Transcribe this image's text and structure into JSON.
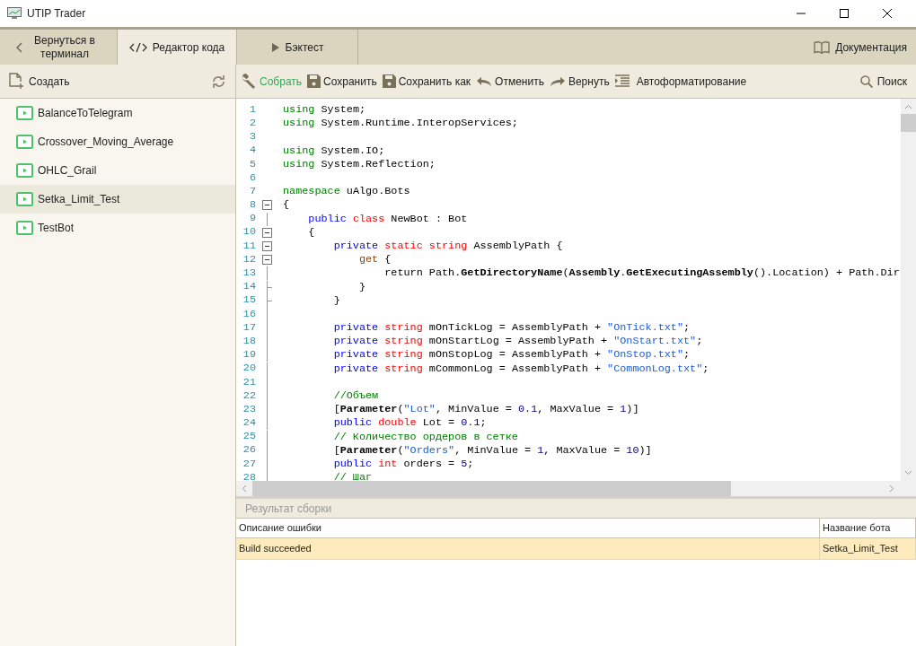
{
  "window": {
    "title": "UTIP Trader"
  },
  "tabs": [
    {
      "label": "Вернуться в терминал",
      "kind": "back",
      "selected": false
    },
    {
      "label": "Редактор кода",
      "kind": "code",
      "selected": true
    },
    {
      "label": "Бэктест",
      "kind": "play",
      "selected": false
    }
  ],
  "docs_link": "Документация",
  "sidebar": {
    "create": "Создать",
    "items": [
      {
        "label": "BalanceToTelegram",
        "selected": false
      },
      {
        "label": "Crossover_Moving_Average",
        "selected": false
      },
      {
        "label": "OHLC_Grail",
        "selected": false
      },
      {
        "label": "Setka_Limit_Test",
        "selected": true
      },
      {
        "label": "TestBot",
        "selected": false
      }
    ]
  },
  "toolbar": [
    {
      "label": "Собрать",
      "kind": "build"
    },
    {
      "label": "Сохранить",
      "kind": "save"
    },
    {
      "label": "Сохранить как",
      "kind": "save"
    },
    {
      "label": "Отменить",
      "kind": "undo"
    },
    {
      "label": "Вернуть",
      "kind": "redo"
    },
    {
      "label": "Автоформатирование",
      "kind": "format"
    }
  ],
  "search": "Поиск",
  "code": [
    {
      "n": "1",
      "kind": "plain",
      "tokens": [
        {
          "kind": "kg",
          "text": "using"
        },
        {
          "kind": "p",
          "text": " System;"
        }
      ]
    },
    {
      "n": "2",
      "kind": "plain",
      "tokens": [
        {
          "kind": "kg",
          "text": "using"
        },
        {
          "kind": "p",
          "text": " System.Runtime.InteropServices;"
        }
      ]
    },
    {
      "n": "3",
      "kind": "plain"
    },
    {
      "n": "4",
      "kind": "plain",
      "tokens": [
        {
          "kind": "kg",
          "text": "using"
        },
        {
          "kind": "p",
          "text": " System.IO;"
        }
      ]
    },
    {
      "n": "5",
      "kind": "plain",
      "tokens": [
        {
          "kind": "kg",
          "text": "using"
        },
        {
          "kind": "p",
          "text": " System.Reflection;"
        }
      ]
    },
    {
      "n": "6",
      "kind": "plain"
    },
    {
      "n": "7",
      "kind": "plain",
      "tokens": [
        {
          "kind": "kg",
          "text": "namespace"
        },
        {
          "kind": "p",
          "text": " uAlgo.Bots"
        }
      ]
    },
    {
      "n": "8",
      "kind": "fold_start",
      "tokens": [
        {
          "kind": "p",
          "text": "{"
        }
      ]
    },
    {
      "n": "9",
      "kind": "fold_body",
      "tokens": [
        {
          "kind": "kb",
          "text": "    public"
        },
        {
          "kind": "kr",
          "text": " class"
        },
        {
          "kind": "p",
          "text": " NewBot : Bot"
        }
      ]
    },
    {
      "n": "10",
      "kind": "fold_start",
      "tokens": [
        {
          "kind": "p",
          "text": "    {"
        }
      ]
    },
    {
      "n": "11",
      "kind": "fold_start",
      "tokens": [
        {
          "kind": "kb",
          "text": "        private"
        },
        {
          "kind": "kr",
          "text": " static string"
        },
        {
          "kind": "p",
          "text": " AssemblyPath {"
        }
      ]
    },
    {
      "n": "12",
      "kind": "fold_start",
      "tokens": [
        {
          "kind": "kd",
          "text": "            get"
        },
        {
          "kind": "p",
          "text": " {"
        }
      ]
    },
    {
      "n": "13",
      "kind": "fold_body",
      "tokens": [
        {
          "kind": "p",
          "text": "                return Path."
        },
        {
          "kind": "b",
          "text": "GetDirectoryName"
        },
        {
          "kind": "p",
          "text": "("
        },
        {
          "kind": "b",
          "text": "Assembly"
        },
        {
          "kind": "p",
          "text": "."
        },
        {
          "kind": "b",
          "text": "GetExecutingAssembly"
        },
        {
          "kind": "p",
          "text": "().Location) + Path.Dir"
        }
      ]
    },
    {
      "n": "14",
      "kind": "fold_end",
      "tokens": [
        {
          "kind": "p",
          "text": "            }"
        }
      ]
    },
    {
      "n": "15",
      "kind": "fold_end",
      "tokens": [
        {
          "kind": "p",
          "text": "        }"
        }
      ]
    },
    {
      "n": "16",
      "kind": "fold_body"
    },
    {
      "n": "17",
      "kind": "fold_body",
      "tokens": [
        {
          "kind": "kb",
          "text": "        private"
        },
        {
          "kind": "kr",
          "text": " string"
        },
        {
          "kind": "p",
          "text": " mOnTickLog = AssemblyPath + "
        },
        {
          "kind": "s",
          "text": "\"OnTick.txt\""
        },
        {
          "kind": "p",
          "text": ";"
        }
      ]
    },
    {
      "n": "18",
      "kind": "fold_body",
      "tokens": [
        {
          "kind": "kb",
          "text": "        private"
        },
        {
          "kind": "kr",
          "text": " string"
        },
        {
          "kind": "p",
          "text": " mOnStartLog = AssemblyPath + "
        },
        {
          "kind": "s",
          "text": "\"OnStart.txt\""
        },
        {
          "kind": "p",
          "text": ";"
        }
      ]
    },
    {
      "n": "19",
      "kind": "fold_body",
      "tokens": [
        {
          "kind": "kb",
          "text": "        private"
        },
        {
          "kind": "kr",
          "text": " string"
        },
        {
          "kind": "p",
          "text": " mOnStopLog = AssemblyPath + "
        },
        {
          "kind": "s",
          "text": "\"OnStop.txt\""
        },
        {
          "kind": "p",
          "text": ";"
        }
      ]
    },
    {
      "n": "20",
      "kind": "fold_body",
      "tokens": [
        {
          "kind": "kb",
          "text": "        private"
        },
        {
          "kind": "kr",
          "text": " string"
        },
        {
          "kind": "p",
          "text": " mCommonLog = AssemblyPath + "
        },
        {
          "kind": "s",
          "text": "\"CommonLog.txt\""
        },
        {
          "kind": "p",
          "text": ";"
        }
      ]
    },
    {
      "n": "21",
      "kind": "fold_body"
    },
    {
      "n": "22",
      "kind": "fold_body",
      "tokens": [
        {
          "kind": "c",
          "text": "        //Объем"
        }
      ]
    },
    {
      "n": "23",
      "kind": "fold_body",
      "tokens": [
        {
          "kind": "p",
          "text": "        ["
        },
        {
          "kind": "b",
          "text": "Parameter"
        },
        {
          "kind": "p",
          "text": "("
        },
        {
          "kind": "s",
          "text": "\"Lot\""
        },
        {
          "kind": "p",
          "text": ", MinValue = "
        },
        {
          "kind": "num",
          "text": "0.1"
        },
        {
          "kind": "p",
          "text": ", MaxValue = "
        },
        {
          "kind": "num",
          "text": "1"
        },
        {
          "kind": "p",
          "text": ")]"
        }
      ]
    },
    {
      "n": "24",
      "kind": "fold_body",
      "tokens": [
        {
          "kind": "kb",
          "text": "        public"
        },
        {
          "kind": "kr",
          "text": " double"
        },
        {
          "kind": "p",
          "text": " Lot = "
        },
        {
          "kind": "num",
          "text": "0.1"
        },
        {
          "kind": "p",
          "text": ";"
        }
      ]
    },
    {
      "n": "25",
      "kind": "fold_body",
      "tokens": [
        {
          "kind": "c",
          "text": "        // Количество ордеров в сетке"
        }
      ]
    },
    {
      "n": "26",
      "kind": "fold_body",
      "tokens": [
        {
          "kind": "p",
          "text": "        ["
        },
        {
          "kind": "b",
          "text": "Parameter"
        },
        {
          "kind": "p",
          "text": "("
        },
        {
          "kind": "s",
          "text": "\"Orders\""
        },
        {
          "kind": "p",
          "text": ", MinValue = "
        },
        {
          "kind": "num",
          "text": "1"
        },
        {
          "kind": "p",
          "text": ", MaxValue = "
        },
        {
          "kind": "num",
          "text": "10"
        },
        {
          "kind": "p",
          "text": ")]"
        }
      ]
    },
    {
      "n": "27",
      "kind": "fold_body",
      "tokens": [
        {
          "kind": "kb",
          "text": "        public"
        },
        {
          "kind": "kr",
          "text": " int"
        },
        {
          "kind": "p",
          "text": " orders = "
        },
        {
          "kind": "num",
          "text": "5"
        },
        {
          "kind": "p",
          "text": ";"
        }
      ]
    },
    {
      "n": "28",
      "kind": "fold_body",
      "tokens": [
        {
          "kind": "c",
          "text": "        // Шаг"
        }
      ]
    }
  ],
  "results": {
    "title": "Результат сборки",
    "columns": [
      "Описание ошибки",
      "Название бота"
    ],
    "rows": [
      {
        "cells": [
          "Build succeeded",
          "Setka_Limit_Test"
        ],
        "selected": true
      }
    ]
  }
}
